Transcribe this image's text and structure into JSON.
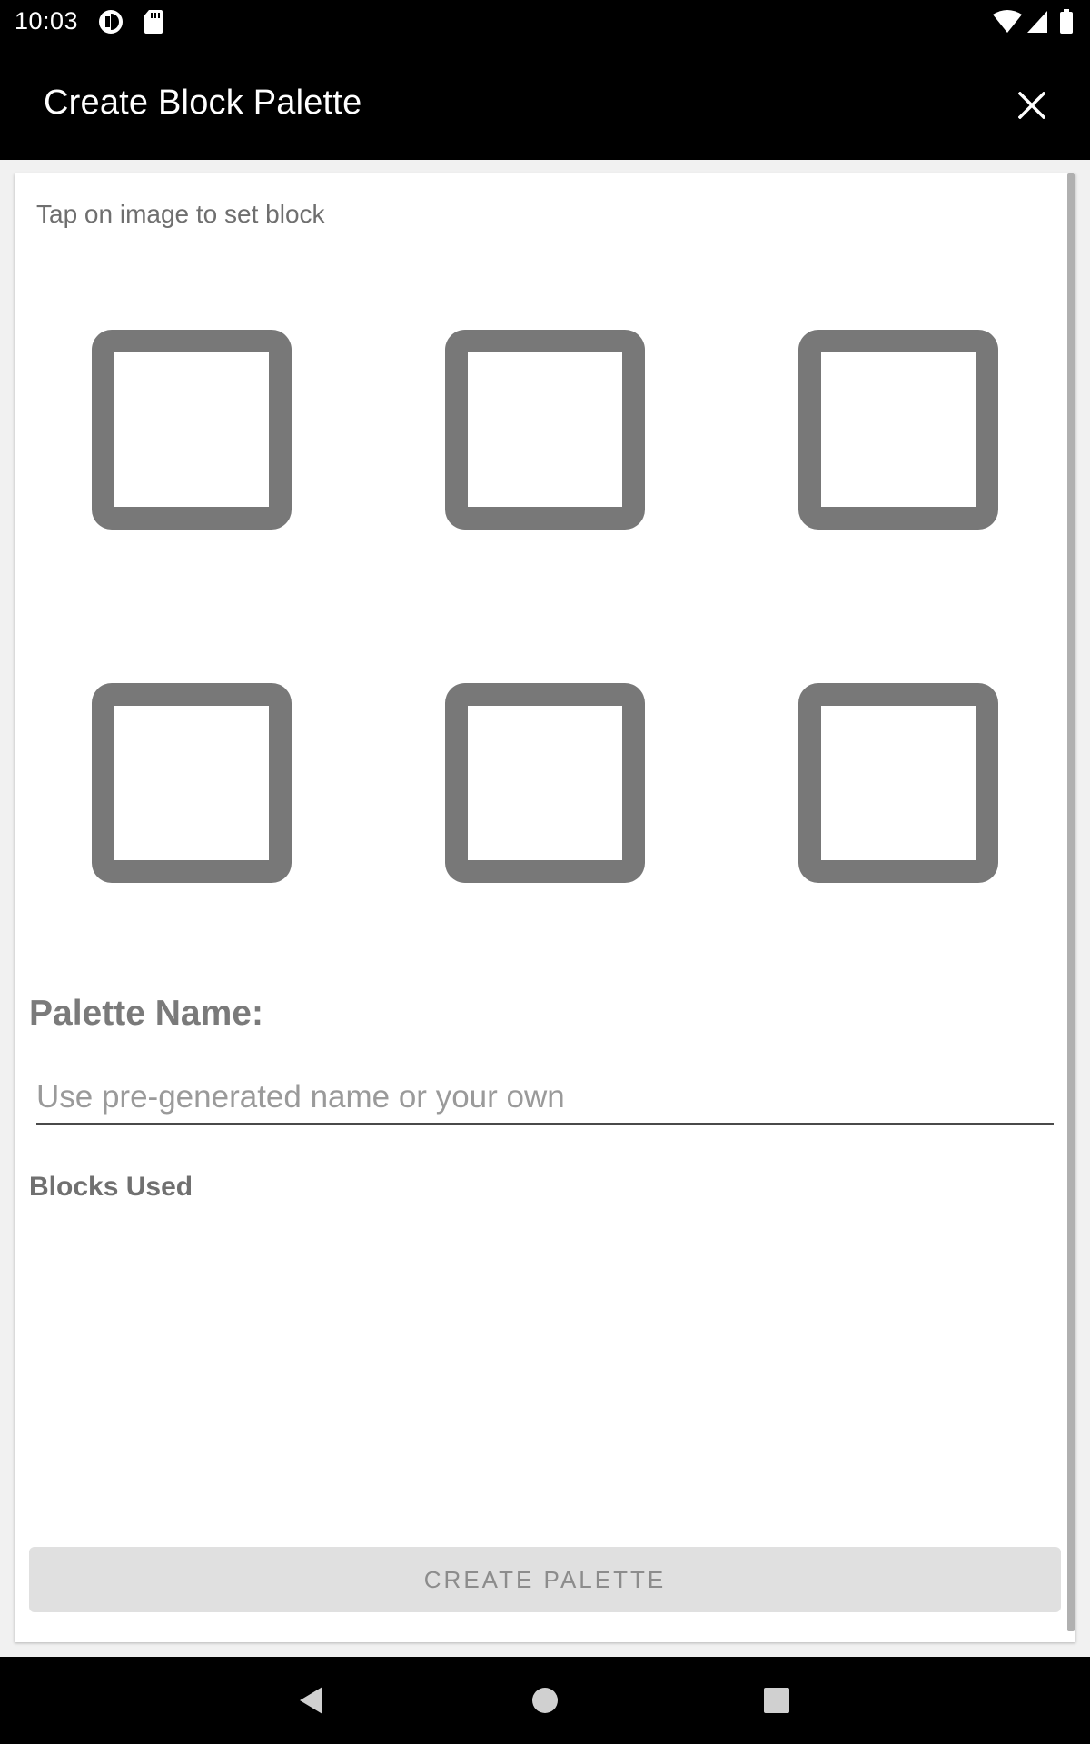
{
  "status_bar": {
    "time": "10:03",
    "icons": [
      "pie-notification-icon",
      "sd-card-icon",
      "wifi-icon",
      "cell-signal-icon",
      "battery-icon"
    ]
  },
  "app_bar": {
    "title": "Create Block Palette",
    "close_icon": "close-icon"
  },
  "content": {
    "hint": "Tap on image to set block",
    "block_slots": [
      {
        "id": 1,
        "state": "empty"
      },
      {
        "id": 2,
        "state": "empty"
      },
      {
        "id": 3,
        "state": "empty"
      },
      {
        "id": 4,
        "state": "empty"
      },
      {
        "id": 5,
        "state": "empty"
      },
      {
        "id": 6,
        "state": "empty"
      }
    ],
    "palette_name_label": "Palette Name:",
    "palette_name_value": "",
    "palette_name_placeholder": "Use pre-generated name or your own",
    "blocks_used_label": "Blocks Used",
    "create_button_label": "CREATE PALETTE"
  },
  "nav_bar": {
    "buttons": [
      "back-icon",
      "home-icon",
      "recents-icon"
    ]
  },
  "colors": {
    "slot_border": "#787878",
    "button_bg": "#e0e0e0",
    "button_text": "#8c8c8c",
    "bars": "#000000"
  }
}
